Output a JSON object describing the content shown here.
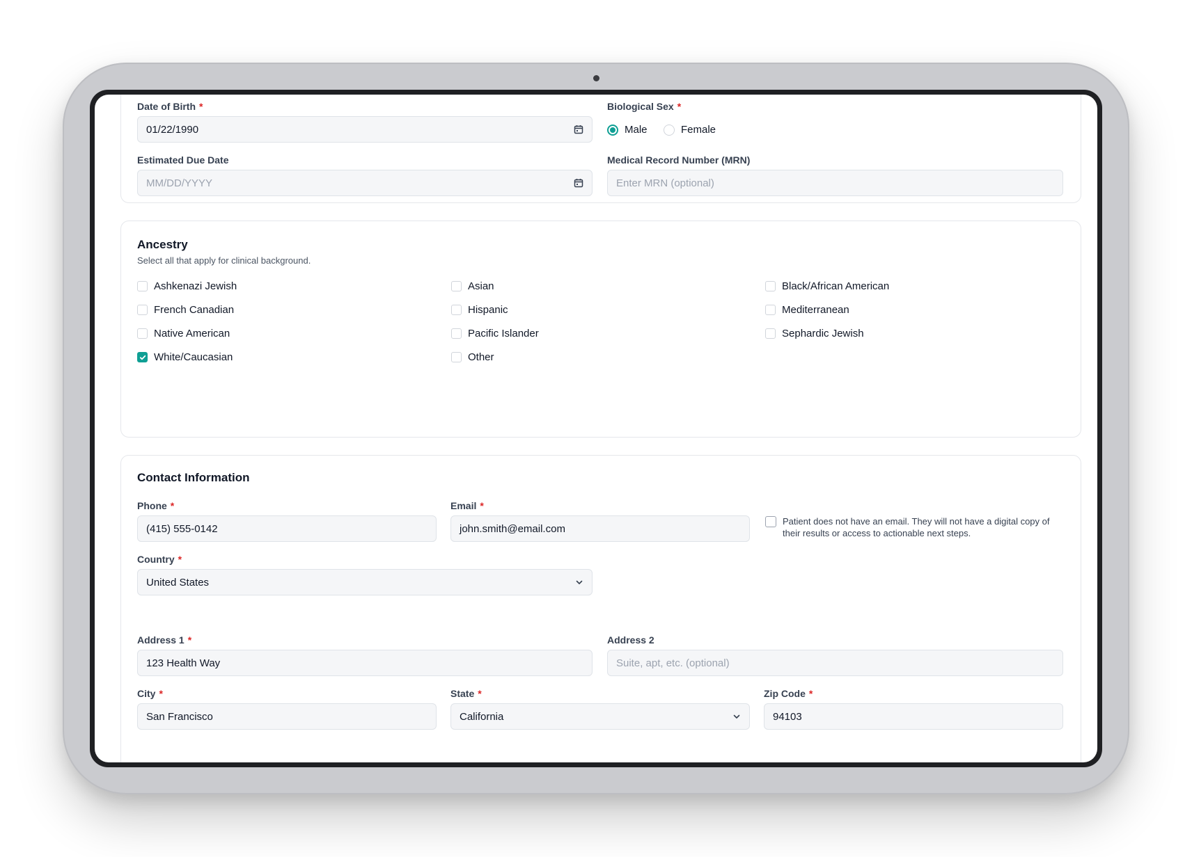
{
  "demographics": {
    "dob": {
      "label": "Date of Birth",
      "value": "01/22/1990",
      "icon": "calendar-icon"
    },
    "sex": {
      "label": "Biological Sex",
      "options": [
        "Male",
        "Female"
      ],
      "selected": "Male"
    },
    "due_date": {
      "label": "Estimated Due Date",
      "placeholder": "MM/DD/YYYY",
      "icon": "calendar-icon"
    },
    "mrn": {
      "label": "Medical Record Number (MRN)",
      "placeholder": "Enter MRN (optional)"
    }
  },
  "ancestry": {
    "title": "Ancestry",
    "subtitle": "Select all that apply for clinical background.",
    "options": [
      {
        "label": "Ashkenazi Jewish",
        "checked": false
      },
      {
        "label": "Asian",
        "checked": false
      },
      {
        "label": "Black/African American",
        "checked": false
      },
      {
        "label": "French Canadian",
        "checked": false
      },
      {
        "label": "Hispanic",
        "checked": false
      },
      {
        "label": "Mediterranean",
        "checked": false
      },
      {
        "label": "Native American",
        "checked": false
      },
      {
        "label": "Pacific Islander",
        "checked": false
      },
      {
        "label": "Sephardic Jewish",
        "checked": false
      },
      {
        "label": "White/Caucasian",
        "checked": true
      },
      {
        "label": "Other",
        "checked": false
      }
    ]
  },
  "contact": {
    "title": "Contact Information",
    "phone": {
      "label": "Phone",
      "value": "(415) 555-0142"
    },
    "email": {
      "label": "Email",
      "value": "john.smith@email.com"
    },
    "no_email_note": "Patient does not have an email. They will not have a digital copy of their results or access to actionable next steps.",
    "country": {
      "label": "Country",
      "value": "United States"
    },
    "address1": {
      "label": "Address 1",
      "value": "123 Health Way"
    },
    "address2": {
      "label": "Address 2",
      "placeholder": "Suite, apt, etc. (optional)"
    },
    "city": {
      "label": "City",
      "value": "San Francisco"
    },
    "state": {
      "label": "State",
      "value": "California"
    },
    "zip": {
      "label": "Zip Code",
      "value": "94103"
    },
    "required_mark": "*"
  },
  "colors": {
    "accent": "#0f9f94",
    "required": "#dc2626",
    "border": "#e5e7eb",
    "field_bg": "#f5f6f8"
  }
}
